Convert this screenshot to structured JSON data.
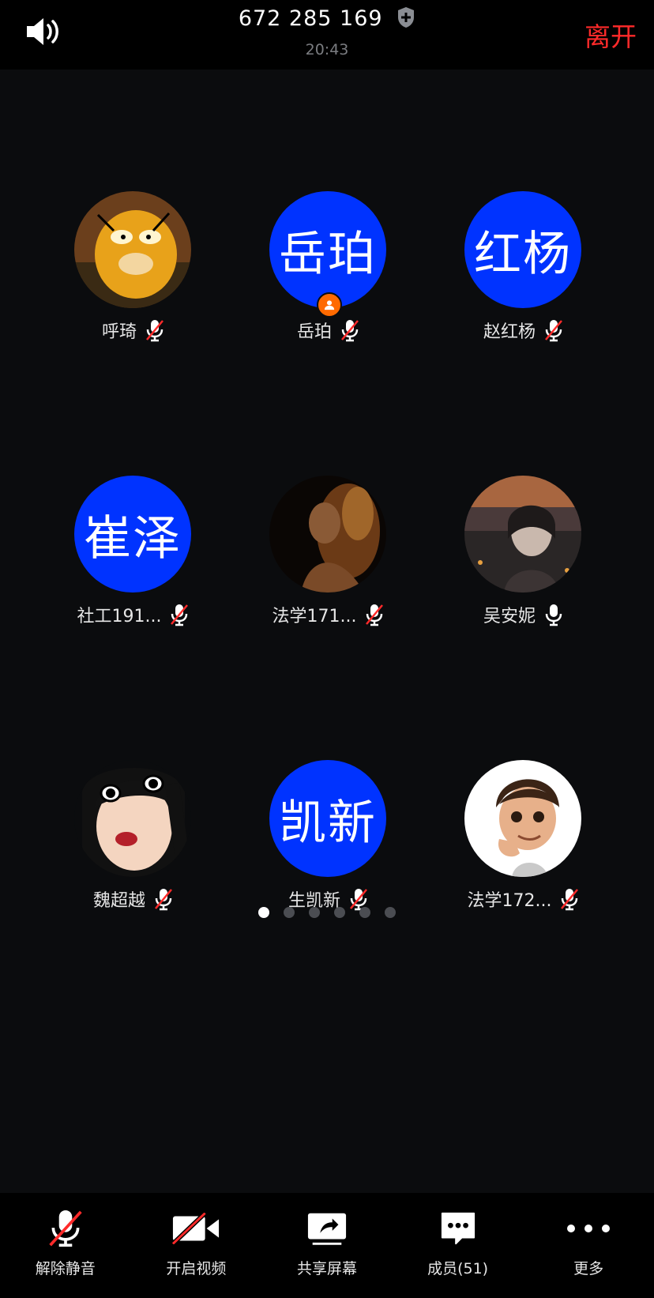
{
  "header": {
    "meeting_id": "672 285 169",
    "time": "20:43",
    "leave_label": "离开"
  },
  "participants": [
    {
      "name": "呼琦",
      "avatar_text": "",
      "mic": "muted"
    },
    {
      "name": "岳珀",
      "avatar_text": "岳珀",
      "mic": "muted",
      "host": true
    },
    {
      "name": "赵红杨",
      "avatar_text": "红杨",
      "mic": "muted"
    },
    {
      "name": "社工191...",
      "avatar_text": "崔泽",
      "mic": "muted"
    },
    {
      "name": "法学171...",
      "avatar_text": "",
      "mic": "muted"
    },
    {
      "name": "吴安妮",
      "avatar_text": "",
      "mic": "on"
    },
    {
      "name": "魏超越",
      "avatar_text": "",
      "mic": "muted"
    },
    {
      "name": "生凯新",
      "avatar_text": "凯新",
      "mic": "muted"
    },
    {
      "name": "法学172...",
      "avatar_text": "",
      "mic": "muted"
    }
  ],
  "pagination": {
    "total": 6,
    "current": 1
  },
  "toolbar": {
    "unmute": "解除静音",
    "video": "开启视频",
    "share": "共享屏幕",
    "members": "成员(51)",
    "more": "更多"
  },
  "colors": {
    "avatar_blue": "#0033ff",
    "leave_red": "#ff2a2a",
    "host_orange": "#ff6a00",
    "background": "#0b0c0e"
  }
}
